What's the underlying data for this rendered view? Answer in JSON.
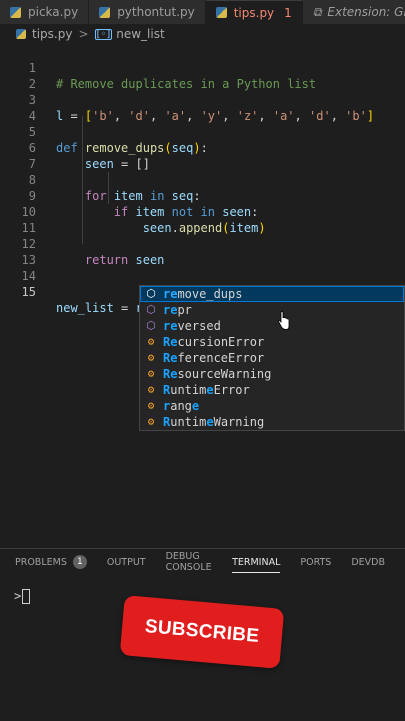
{
  "tabs": [
    {
      "label": "picka.py"
    },
    {
      "label": "pythontut.py"
    },
    {
      "label": "tips.py",
      "badge": "1"
    },
    {
      "label": "Extension: Git"
    }
  ],
  "breadcrumb": {
    "file": "tips.py",
    "symbol": "new_list"
  },
  "editor": {
    "line_numbers": [
      "1",
      "2",
      "3",
      "4",
      "5",
      "6",
      "7",
      "8",
      "9",
      "10",
      "11",
      "12",
      "13",
      "14",
      "15"
    ],
    "line1_comment": "# Remove duplicates in a Python list",
    "line3": {
      "name": "l",
      "op": " = ",
      "items": [
        "'b'",
        "'d'",
        "'a'",
        "'y'",
        "'z'",
        "'a'",
        "'d'",
        "'b'"
      ]
    },
    "line5": {
      "kw": "def",
      "fn": "remove_dups",
      "param": "seq"
    },
    "line6": {
      "name": "seen",
      "rest": " = []"
    },
    "line8": {
      "kw": "for",
      "var": "item",
      "kw_in": "in",
      "seq": "seq"
    },
    "line9": {
      "kw": "if",
      "var": "item",
      "kw_not": "not",
      "kw_in": "in",
      "target": "seen"
    },
    "line10": {
      "obj": "seen",
      "method": "append",
      "arg": "item"
    },
    "line12": {
      "kw": "return",
      "var": "seen"
    },
    "line15": {
      "name": "new_list",
      "op": " = ",
      "typed": "re"
    }
  },
  "suggestions": [
    {
      "match": "re",
      "rest": "move_dups",
      "kind": "function"
    },
    {
      "match": "re",
      "rest": "pr",
      "kind": "function"
    },
    {
      "match": "re",
      "rest": "versed",
      "kind": "function"
    },
    {
      "match": "R",
      "mid": "e",
      "rest": "cursionError",
      "kind": "class"
    },
    {
      "match": "Re",
      "rest": "ferenceError",
      "kind": "class"
    },
    {
      "match": "Re",
      "rest": "sourceWarning",
      "kind": "class"
    },
    {
      "match": "R",
      "mid": "untim",
      "hl2": "e",
      "rest": "Error",
      "kind": "class"
    },
    {
      "match": "r",
      "mid": "ang",
      "hl2": "e",
      "rest": "",
      "kind": "class"
    },
    {
      "match": "R",
      "mid": "untim",
      "hl2": "e",
      "rest": "Warning",
      "kind": "class"
    }
  ],
  "panel": {
    "tabs": [
      "PROBLEMS",
      "OUTPUT",
      "DEBUG CONSOLE",
      "TERMINAL",
      "PORTS",
      "DEVDB"
    ],
    "problems_count": "1",
    "terminal_prompt": ">"
  },
  "overlay": {
    "subscribe": "SUBSCRIBE"
  }
}
